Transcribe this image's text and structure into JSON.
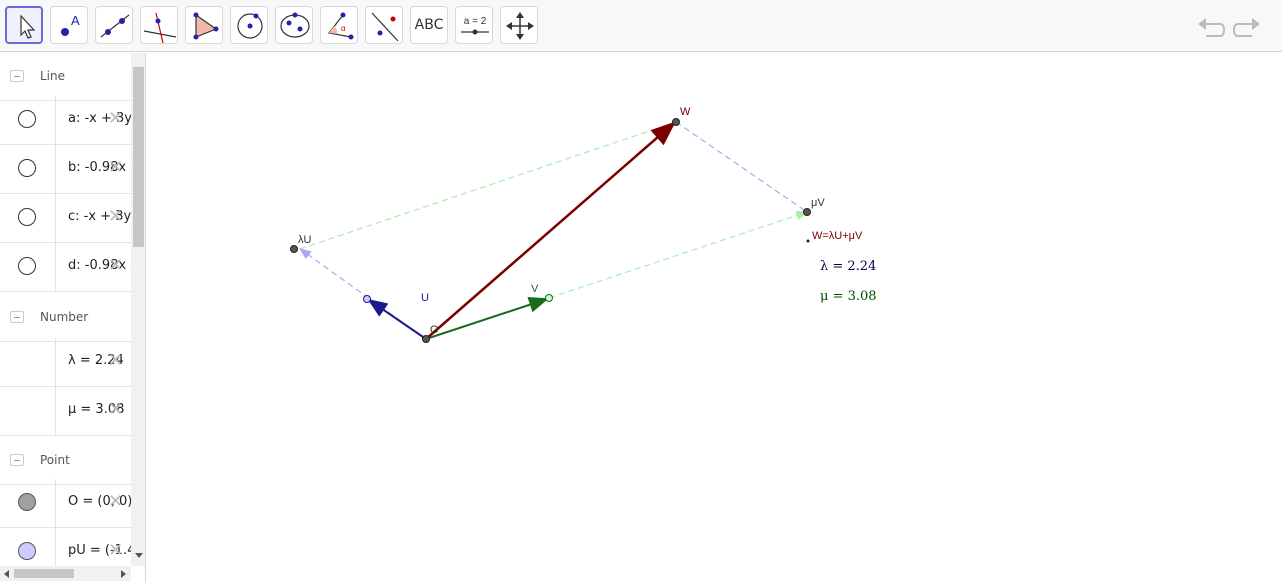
{
  "toolbar": {
    "tools": [
      {
        "name": "move-tool",
        "icon": "cursor-icon"
      },
      {
        "name": "point-tool",
        "icon": "point-icon",
        "label": "A"
      },
      {
        "name": "line-tool",
        "icon": "line-icon"
      },
      {
        "name": "perpendicular-line-tool",
        "icon": "perpendicular-icon"
      },
      {
        "name": "polygon-tool",
        "icon": "polygon-icon"
      },
      {
        "name": "circle-tool",
        "icon": "circle-icon"
      },
      {
        "name": "conic-tool",
        "icon": "ellipse-icon"
      },
      {
        "name": "angle-tool",
        "icon": "angle-icon"
      },
      {
        "name": "reflect-tool",
        "icon": "reflect-icon"
      },
      {
        "name": "text-tool",
        "icon": "text-icon",
        "label": "ABC"
      },
      {
        "name": "slider-tool",
        "icon": "slider-icon",
        "label": "a = 2"
      },
      {
        "name": "move-graphics-view-tool",
        "icon": "move-arrows-icon"
      }
    ],
    "undo_icon": "undo-icon",
    "redo_icon": "redo-icon"
  },
  "algebra": {
    "groups": [
      {
        "title": "Line",
        "items": [
          {
            "expr": "a: -x + 3y",
            "marker": "empty"
          },
          {
            "expr": "b: -0.98x -",
            "marker": "empty"
          },
          {
            "expr": "c: -x + 3y",
            "marker": "empty"
          },
          {
            "expr": "d: -0.98x -",
            "marker": "empty"
          }
        ]
      },
      {
        "title": "Number",
        "items": [
          {
            "expr": "λ = 2.24",
            "marker": "none"
          },
          {
            "expr": "μ = 3.08",
            "marker": "none"
          }
        ]
      },
      {
        "title": "Point",
        "items": [
          {
            "expr": "O = (0, 0)",
            "marker": "gray"
          },
          {
            "expr": "pU = (-1.4",
            "marker": "blue"
          }
        ]
      }
    ],
    "delete_icon": "close-icon"
  },
  "graphics": {
    "labels": {
      "W": "W",
      "muV": "μV",
      "lamU": "λU",
      "U": "U",
      "V": "V",
      "O": "O",
      "equation": "W=λU+μV"
    },
    "lambda_text": "λ = 2.24",
    "mu_text": "μ = 3.08",
    "colors": {
      "w_vector": "#7a0000",
      "u_vector": "#1a1a8c",
      "v_vector": "#1a6b1a",
      "dash_blue": "#aaaaee",
      "dash_green": "#aaeeaa",
      "lambda_color": "#00004d",
      "mu_color": "#004d00"
    }
  }
}
